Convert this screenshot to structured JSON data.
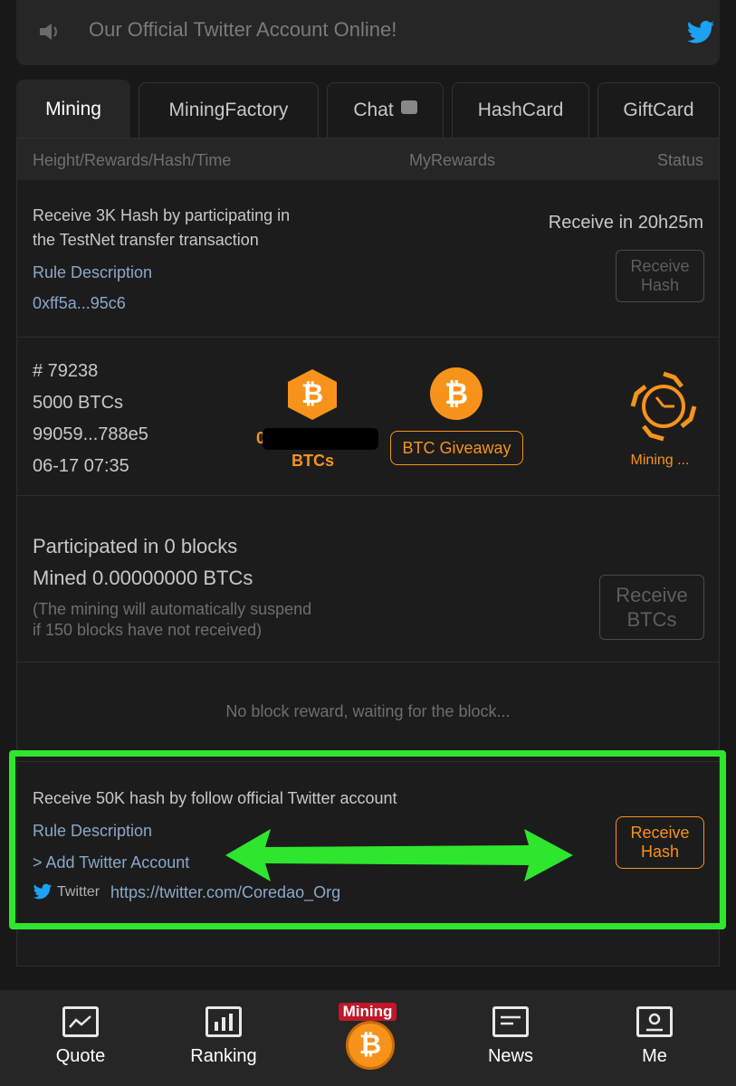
{
  "announcement": {
    "text": "Our Official Twitter Account Online!",
    "icon": "speaker-icon",
    "twitter_icon": "twitter-icon"
  },
  "tabs": [
    {
      "label": "Mining",
      "active": true
    },
    {
      "label": "MiningFactory",
      "active": false
    },
    {
      "label": "Chat",
      "active": false,
      "icon": "chat-bubble-icon"
    },
    {
      "label": "HashCard",
      "active": false
    },
    {
      "label": "GiftCard",
      "active": false
    }
  ],
  "columns": {
    "left": "Height/Rewards/Hash/Time",
    "middle": "MyRewards",
    "right": "Status"
  },
  "testnet_task": {
    "line1": "Receive 3K Hash by participating in",
    "line2": "the TestNet transfer transaction",
    "rule_link": "Rule Description",
    "address": "0xff5a...95c6",
    "countdown": "Receive in 20h25m",
    "button_line1": "Receive",
    "button_line2": "Hash"
  },
  "block": {
    "height": "# 79238",
    "reward": "5000 BTCs",
    "hash": "99059...788e5",
    "time": "06-17 07:35",
    "my_reward_label": "BTCs",
    "my_reward_value_prefix": "0",
    "btc_symbol": "₿",
    "giveaway_label": "BTC Giveaway",
    "status_label": "Mining ..."
  },
  "summary": {
    "participated": "Participated in 0 blocks",
    "mined": "Mined 0.00000000 BTCs",
    "note_line1": "(The mining will automatically suspend",
    "note_line2": "if 150 blocks have not received)",
    "button_line1": "Receive",
    "button_line2": "BTCs"
  },
  "empty_message": "No block reward, waiting for the block...",
  "twitter_task": {
    "title": "Receive 50K hash by follow official Twitter account",
    "rule_link": "Rule Description",
    "add_account": "> Add Twitter Account",
    "twitter_label": "Twitter",
    "twitter_url": "https://twitter.com/Coredao_Org",
    "button_line1": "Receive",
    "button_line2": "Hash"
  },
  "bottom_nav": [
    {
      "label": "Quote",
      "icon": "chart-monitor-icon"
    },
    {
      "label": "Ranking",
      "icon": "bar-chart-icon"
    },
    {
      "label": "Mining",
      "icon": "mining-logo-icon"
    },
    {
      "label": "News",
      "icon": "news-icon"
    },
    {
      "label": "Me",
      "icon": "profile-icon"
    }
  ],
  "colors": {
    "accent": "#f7931a",
    "highlight": "#2ee62e",
    "twitter": "#1da1f2"
  }
}
